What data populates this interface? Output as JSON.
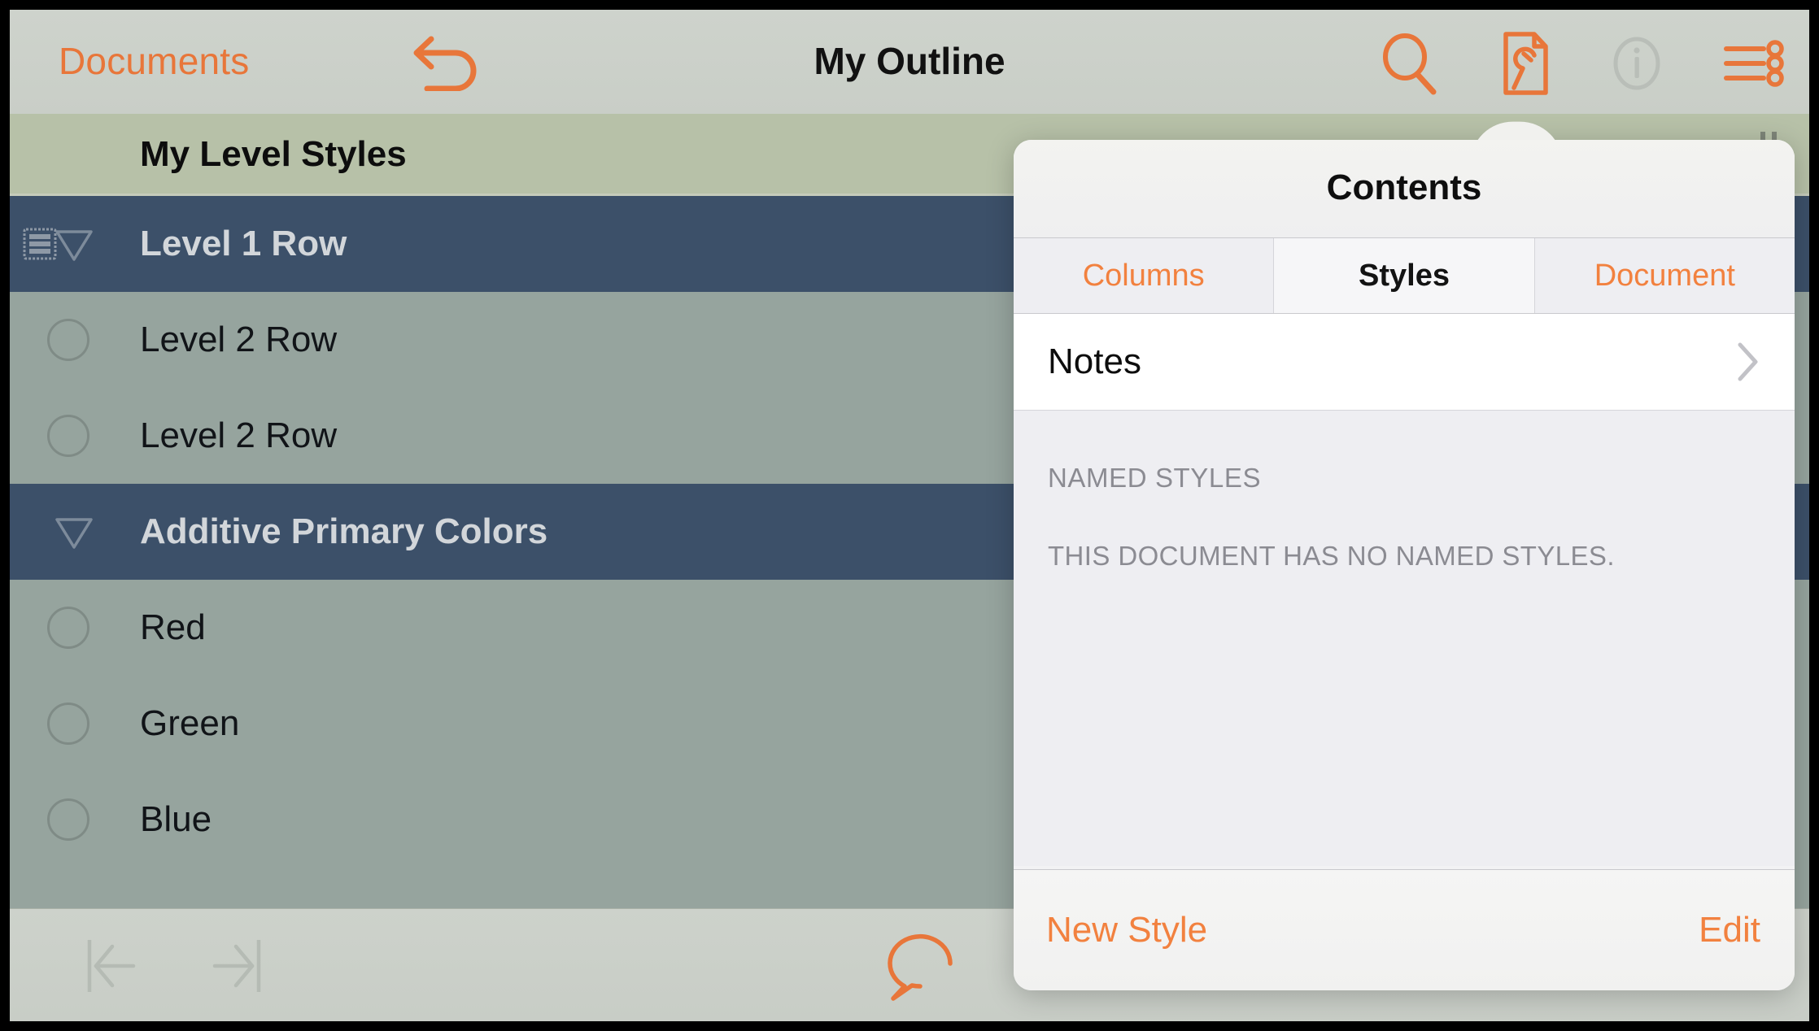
{
  "navbar": {
    "back_label": "Documents",
    "title": "My Outline",
    "undo_icon": "undo-icon",
    "search_icon": "search-icon",
    "contents_icon": "document-wrench-icon",
    "info_icon": "info-icon",
    "more_icon": "list-options-icon"
  },
  "outline": {
    "column_header": "My Level Styles",
    "rows": [
      {
        "label": "Level 1 Row",
        "level": 1,
        "has_note": true,
        "disclosure": "expanded"
      },
      {
        "label": "Level 2 Row",
        "level": 2,
        "has_note": false,
        "disclosure": "none"
      },
      {
        "label": "Level 2 Row",
        "level": 2,
        "has_note": false,
        "disclosure": "none"
      },
      {
        "label": "Additive Primary Colors",
        "level": 1,
        "has_note": false,
        "disclosure": "expanded"
      },
      {
        "label": "Red",
        "level": 2,
        "has_note": false,
        "disclosure": "none"
      },
      {
        "label": "Green",
        "level": 2,
        "has_note": false,
        "disclosure": "none"
      },
      {
        "label": "Blue",
        "level": 2,
        "has_note": false,
        "disclosure": "none"
      }
    ]
  },
  "bottombar": {
    "outdent_icon": "outdent-icon",
    "indent_icon": "indent-icon",
    "comment_icon": "comment-bubble-icon"
  },
  "popover": {
    "title": "Contents",
    "tabs": [
      {
        "label": "Columns",
        "active": false
      },
      {
        "label": "Styles",
        "active": true
      },
      {
        "label": "Document",
        "active": false
      }
    ],
    "notes_row": {
      "label": "Notes",
      "chevron_icon": "chevron-right-icon"
    },
    "named_styles": {
      "section_header": "NAMED STYLES",
      "empty_message": "THIS DOCUMENT HAS NO NAMED STYLES."
    },
    "footer": {
      "new_style_label": "New Style",
      "edit_label": "Edit"
    }
  },
  "colors": {
    "accent_orange": "#f2813f",
    "toolbar_bg": "#cbd0c9",
    "column_header_bg": "#b7c1a8",
    "level1_row_bg": "#3c5069",
    "level2_row_bg": "#96a49e",
    "popover_bg": "#f2f2f4",
    "muted_text": "#8b8b92"
  }
}
